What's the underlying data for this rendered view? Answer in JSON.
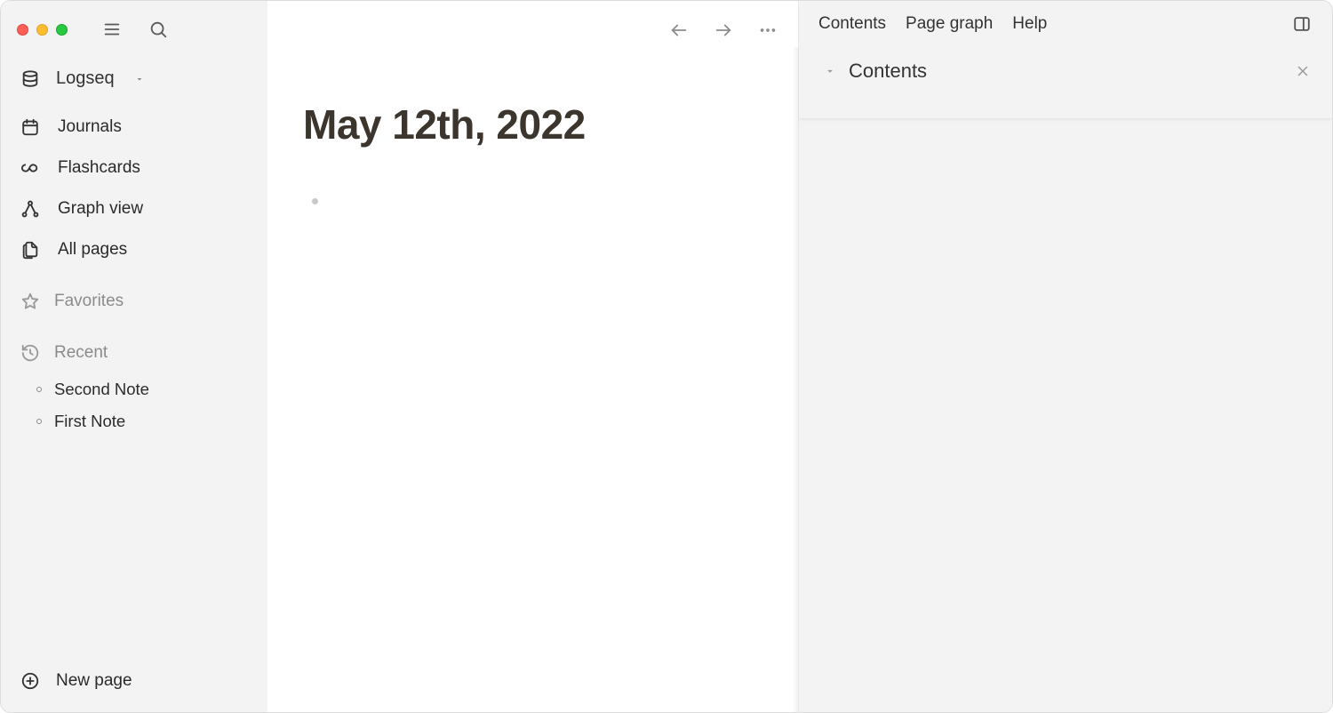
{
  "sidebar": {
    "graph_name": "Logseq",
    "nav": {
      "journals": "Journals",
      "flashcards": "Flashcards",
      "graph_view": "Graph view",
      "all_pages": "All pages"
    },
    "favorites_label": "Favorites",
    "recent_label": "Recent",
    "recent_items": [
      "Second Note",
      "First Note"
    ],
    "new_page_label": "New page"
  },
  "main": {
    "page_title": "May 12th, 2022"
  },
  "right": {
    "tabs": {
      "contents": "Contents",
      "page_graph": "Page graph",
      "help": "Help"
    },
    "panel_title": "Contents"
  }
}
